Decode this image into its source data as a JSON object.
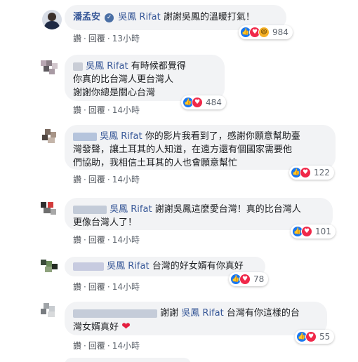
{
  "comments": [
    {
      "author": "潘孟安",
      "tag": "吳鳳 Rifat",
      "text": "謝謝吳鳳的溫暖打氣！",
      "actions": {
        "like": "讚",
        "reply": "回覆",
        "time": "13小時"
      },
      "reactions": {
        "count": "984",
        "types": [
          "like-icon",
          "love-icon",
          "haha-icon"
        ]
      }
    },
    {
      "tag": "吳鳳 Rifat",
      "line1": "有時候都覺得",
      "line2": "你真的比台灣人更台灣人",
      "line3": "謝謝你總是關心台灣",
      "actions": {
        "like": "讚",
        "reply": "回覆",
        "time": "14小時"
      },
      "reactions": {
        "count": "484",
        "types": [
          "like-icon",
          "love-icon"
        ]
      }
    },
    {
      "tag": "吳鳳 Rifat",
      "line1": "你的影片我看到了，感謝你願意幫助臺",
      "line2": "灣發聲，讓土耳其的人知道，在遠方還有個國家需要他",
      "line3": "們協助，我相信土耳其的人也會願意幫忙",
      "actions": {
        "like": "讚",
        "reply": "回覆",
        "time": "14小時"
      },
      "reactions": {
        "count": "122",
        "types": [
          "like-icon",
          "love-icon"
        ]
      }
    },
    {
      "tag": "吳鳳 Rifat",
      "line1": "謝謝吳鳳這麼愛台灣！真的比台灣人",
      "line2": "更像台灣人了！",
      "actions": {
        "like": "讚",
        "reply": "回覆",
        "time": "14小時"
      },
      "reactions": {
        "count": "101",
        "types": [
          "like-icon",
          "love-icon"
        ]
      }
    },
    {
      "tag": "吳鳳 Rifat",
      "line1": "台灣的好女婿有你真好",
      "actions": {
        "like": "讚",
        "reply": "回覆",
        "time": "14小時"
      },
      "reactions": {
        "count": "78",
        "types": [
          "like-icon",
          "love-icon"
        ]
      }
    },
    {
      "lead": "謝謝",
      "tag": "吳鳳 Rifat",
      "line1": "台灣有你這樣的台",
      "line2": "灣女婿真好",
      "actions": {
        "like": "讚",
        "reply": "回覆",
        "time": "14小時"
      },
      "reactions": {
        "count": "55",
        "types": [
          "like-icon",
          "love-icon"
        ]
      }
    }
  ],
  "separator": "·",
  "colors": {
    "link": "#385898",
    "bubble": "#f2f3f5",
    "like": "#1877f2",
    "love": "#f02849"
  }
}
